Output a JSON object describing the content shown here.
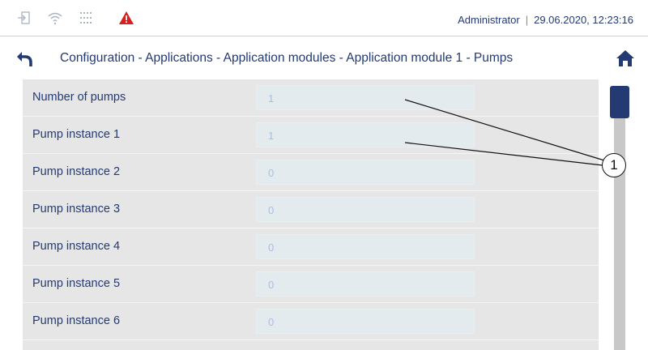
{
  "status_bar": {
    "icons": [
      "login-icon",
      "wifi-icon",
      "keypad-grid-icon",
      "warning-icon"
    ],
    "user": "Administrator",
    "separator": "|",
    "datetime": "29.06.2020, 12:23:16",
    "warning_color": "#d62020"
  },
  "nav": {
    "breadcrumb": "Configuration - Applications - Application modules - Application module 1 - Pumps",
    "back_icon": "back-arrow-icon",
    "home_icon": "home-icon"
  },
  "rows": [
    {
      "label": "Number of pumps",
      "value": "1"
    },
    {
      "label": "Pump instance 1",
      "value": "1"
    },
    {
      "label": "Pump instance 2",
      "value": "0"
    },
    {
      "label": "Pump instance 3",
      "value": "0"
    },
    {
      "label": "Pump instance 4",
      "value": "0"
    },
    {
      "label": "Pump instance 5",
      "value": "0"
    },
    {
      "label": "Pump instance 6",
      "value": "0"
    }
  ],
  "callout": {
    "number": "1"
  },
  "colors": {
    "accent": "#233a72",
    "row_bg": "#e6e6e6",
    "field_bg": "#e4ebef"
  }
}
